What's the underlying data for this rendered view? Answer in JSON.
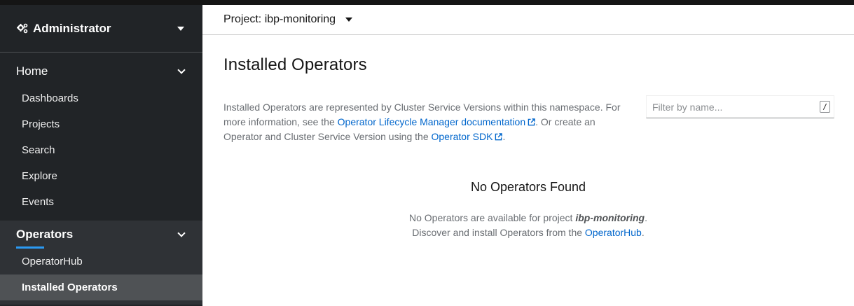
{
  "sidebar": {
    "perspective": {
      "label": "Administrator",
      "icon": "gears-icon"
    },
    "home": {
      "label": "Home",
      "items": [
        "Dashboards",
        "Projects",
        "Search",
        "Explore",
        "Events"
      ]
    },
    "operators": {
      "label": "Operators",
      "items": [
        "OperatorHub",
        "Installed Operators"
      ],
      "active": "Installed Operators"
    }
  },
  "project_bar": {
    "label": "Project: ibp-monitoring"
  },
  "page": {
    "title": "Installed Operators",
    "description": {
      "part1": "Installed Operators are represented by Cluster Service Versions within this namespace. For more information, see the ",
      "link1": "Operator Lifecycle Manager documentation",
      "part2": ". Or create an Operator and Cluster Service Version using the ",
      "link2": "Operator SDK",
      "part3": "."
    },
    "filter": {
      "placeholder": "Filter by name...",
      "shortcut": "/"
    },
    "empty_state": {
      "title": "No Operators Found",
      "line1_prefix": "No Operators are available for project ",
      "project": "ibp-monitoring",
      "line1_suffix": ".",
      "line2_prefix": "Discover and install Operators from the ",
      "link": "OperatorHub",
      "line2_suffix": "."
    }
  },
  "colors": {
    "sidebar_bg": "#212427",
    "link": "#0066cc",
    "active_item_bg": "#4f5255",
    "accent_underline": "#2b9af3"
  }
}
